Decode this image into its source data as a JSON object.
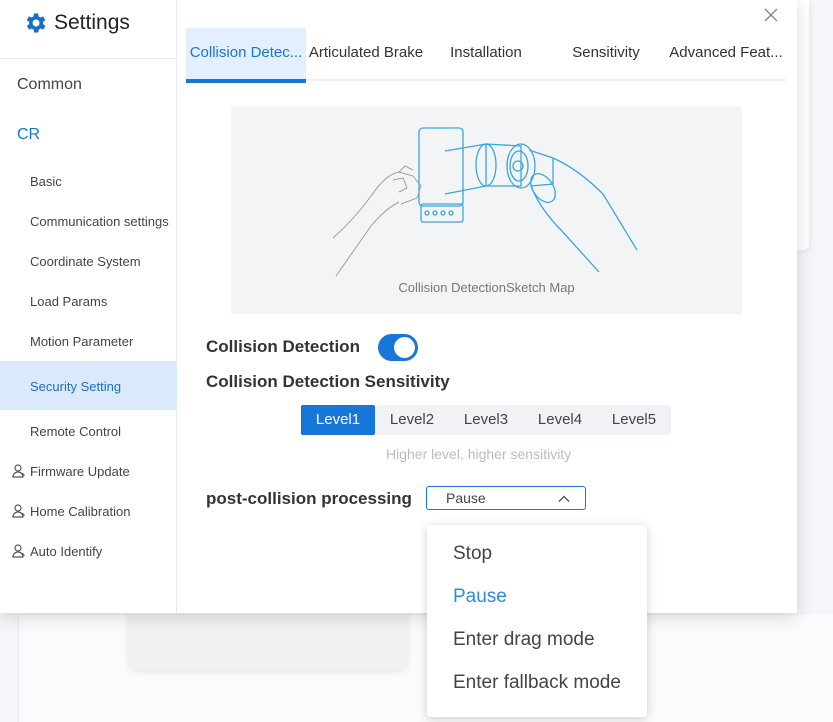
{
  "app": {
    "title": "Settings"
  },
  "sidebar": {
    "common": "Common",
    "cr": "CR",
    "sub_items": [
      {
        "label": "Basic"
      },
      {
        "label": "Communication settings"
      },
      {
        "label": "Coordinate System"
      },
      {
        "label": "Load Params"
      },
      {
        "label": "Motion Parameter"
      },
      {
        "label": "Security Setting"
      },
      {
        "label": "Remote Control"
      }
    ],
    "user_items": [
      {
        "label": "Firmware Update"
      },
      {
        "label": "Home Calibration"
      },
      {
        "label": "Auto Identify"
      }
    ],
    "active_item": "Security Setting"
  },
  "tabs": [
    {
      "label": "Collision Detec..."
    },
    {
      "label": "Articulated Brake"
    },
    {
      "label": "Installation"
    },
    {
      "label": "Sensitivity"
    },
    {
      "label": "Advanced Feat..."
    }
  ],
  "active_tab": "Collision Detec...",
  "sketch": {
    "caption": "Collision DetectionSketch Map"
  },
  "collision": {
    "toggle_label": "Collision Detection",
    "toggle_on": true,
    "sensitivity_label": "Collision Detection Sensitivity",
    "levels": [
      "Level1",
      "Level2",
      "Level3",
      "Level4",
      "Level5"
    ],
    "selected_level": "Level1",
    "hint": "Higher level, higher sensitivity"
  },
  "post_collision": {
    "label": "post-collision processing",
    "value": "Pause",
    "options": [
      "Stop",
      "Pause",
      "Enter drag mode",
      "Enter fallback mode"
    ],
    "selected": "Pause"
  },
  "colors": {
    "accent": "#1677d9",
    "active_bg": "#dbeafa",
    "sketch_line": "#3aa6dc"
  }
}
